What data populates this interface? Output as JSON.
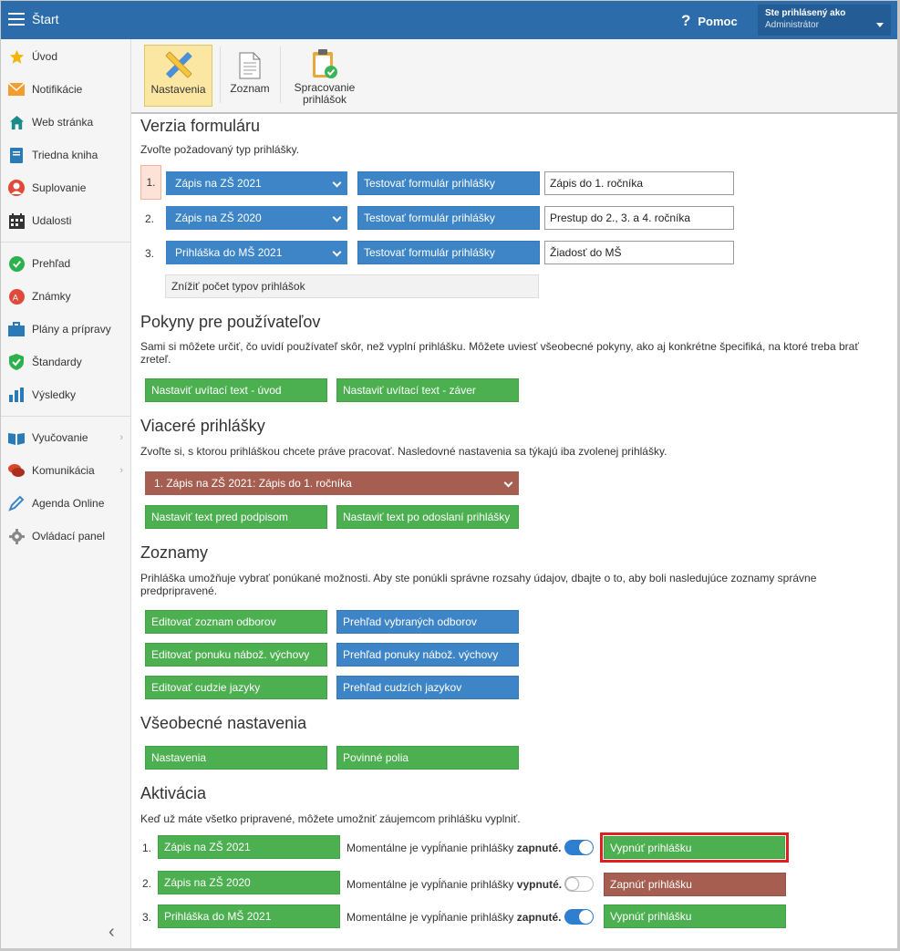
{
  "header": {
    "title": "Štart",
    "help_label": "Pomoc",
    "user_line1": "Ste prihlásený ako",
    "user_line2": "Administrátor"
  },
  "sidebar": {
    "items": [
      {
        "label": "Úvod",
        "icon": "star-icon"
      },
      {
        "label": "Notifikácie",
        "icon": "envelope-icon"
      },
      {
        "label": "Web stránka",
        "icon": "house-icon"
      },
      {
        "label": "Triedna kniha",
        "icon": "book-icon"
      },
      {
        "label": "Suplovanie",
        "icon": "person-icon"
      },
      {
        "label": "Udalosti",
        "icon": "calendar-icon"
      },
      {
        "label": "Prehľad",
        "icon": "check-circle-icon"
      },
      {
        "label": "Známky",
        "icon": "grade-icon"
      },
      {
        "label": "Plány a prípravy",
        "icon": "briefcase-icon"
      },
      {
        "label": "Štandardy",
        "icon": "shield-icon"
      },
      {
        "label": "Výsledky",
        "icon": "bar-chart-icon"
      },
      {
        "label": "Vyučovanie",
        "icon": "open-book-icon"
      },
      {
        "label": "Komunikácia",
        "icon": "chat-icon"
      },
      {
        "label": "Agenda Online",
        "icon": "pen-icon"
      },
      {
        "label": "Ovládací panel",
        "icon": "gear-icon"
      }
    ]
  },
  "toolbar": {
    "settings_label": "Nastavenia",
    "list_label": "Zoznam",
    "processing_label_1": "Spracovanie",
    "processing_label_2": "prihlášok"
  },
  "form_version": {
    "title": "Verzia formuláru",
    "description": "Zvoľte požadovaný typ prihlášky.",
    "rows": [
      {
        "num": "1.",
        "select": "Zápis na ZŠ 2021",
        "test_button": "Testovať formulár prihlášky",
        "name": "Zápis do 1. ročníka"
      },
      {
        "num": "2.",
        "select": "Zápis na ZŠ 2020",
        "test_button": "Testovať formulár prihlášky",
        "name": "Prestup do 2., 3. a 4. ročníka"
      },
      {
        "num": "3.",
        "select": "Prihláška do MŠ 2021",
        "test_button": "Testovať formulár prihlášky",
        "name": "Žiadosť do MŠ"
      }
    ],
    "reduce_button": "Znížiť počet typov prihlášok"
  },
  "instructions": {
    "title": "Pokyny pre používateľov",
    "description_1": "Sami si môžete určiť, čo uvidí používateľ skôr, než vyplní prihlášku. Môžete uviesť všeobecné pokyny, ako aj konkrétne špecifiká, na ktoré treba brať",
    "description_2": "zreteľ.",
    "intro_button": "Nastaviť uvítací text - úvod",
    "outro_button": "Nastaviť uvítací text - záver"
  },
  "multiple": {
    "title": "Viaceré prihlášky",
    "description": "Zvoľte si, s ktorou prihláškou chcete práve pracovať. Nasledovné nastavenia sa týkajú iba zvolenej prihlášky.",
    "select": "1. Zápis na ZŠ 2021: Zápis do 1. ročníka",
    "before_sign_button": "Nastaviť text pred podpisom",
    "after_send_button": "Nastaviť text po odoslaní prihlášky"
  },
  "lists": {
    "title": "Zoznamy",
    "description_1": "Prihláška umožňuje vybrať ponúkané možnosti. Aby ste ponúkli správne rozsahy údajov, dbajte o to, aby boli nasledujúce zoznamy správne",
    "description_2": "predpripravené.",
    "edit_fields": "Editovať zoznam odborov",
    "view_fields": "Prehľad vybraných odborov",
    "edit_religion": "Editovať ponuku nábož. výchovy",
    "view_religion": "Prehľad ponuky nábož. výchovy",
    "edit_languages": "Editovať cudzie jazyky",
    "view_languages": "Prehľad cudzích jazykov"
  },
  "general": {
    "title": "Všeobecné nastavenia",
    "settings_button": "Nastavenia",
    "required_button": "Povinné polia"
  },
  "activation": {
    "title": "Aktivácia",
    "description": "Keď už máte všetko pripravené, môžete umožniť záujemcom prihlášku vyplniť.",
    "status_prefix": "Momentálne je vypĺňanie prihlášky",
    "rows": [
      {
        "num": "1.",
        "name": "Zápis na ZŠ 2021",
        "state": "zapnuté.",
        "on": true,
        "action": "Vypnúť prihlášku"
      },
      {
        "num": "2.",
        "name": "Zápis na ZŠ 2020",
        "state": "vypnuté.",
        "on": false,
        "action": "Zapnúť prihlášku"
      },
      {
        "num": "3.",
        "name": "Prihláška do MŠ 2021",
        "state": "zapnuté.",
        "on": true,
        "action": "Vypnúť prihlášku"
      }
    ]
  },
  "colors": {
    "header": "#2c6cab",
    "green": "#4caf50",
    "blue": "#3d85c6",
    "brown": "#a65e50",
    "highlight": "#e02020"
  }
}
